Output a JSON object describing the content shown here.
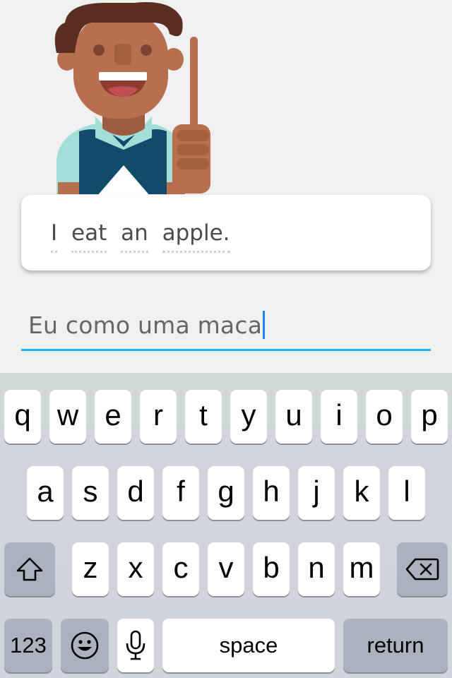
{
  "prompt": {
    "words": [
      "I",
      "eat",
      "an",
      "apple."
    ]
  },
  "answer": {
    "value": "Eu como uma maca"
  },
  "keyboard": {
    "row1": [
      "q",
      "w",
      "e",
      "r",
      "t",
      "y",
      "u",
      "i",
      "o",
      "p"
    ],
    "row2": [
      "a",
      "s",
      "d",
      "f",
      "g",
      "h",
      "j",
      "k",
      "l"
    ],
    "row3": [
      "z",
      "x",
      "c",
      "v",
      "b",
      "n",
      "m"
    ],
    "numbers_label": "123",
    "space_label": "space",
    "return_label": "return",
    "shift_icon": "shift-icon",
    "delete_icon": "backspace-icon",
    "emoji_icon": "emoji-icon",
    "mic_icon": "microphone-icon"
  },
  "colors": {
    "accent": "#1cb0f6",
    "key_dark": "#abb2bd",
    "skin": "#b86f4f",
    "vest": "#124a6b",
    "shirt": "#a3dfd9",
    "hair": "#5a2e22"
  }
}
